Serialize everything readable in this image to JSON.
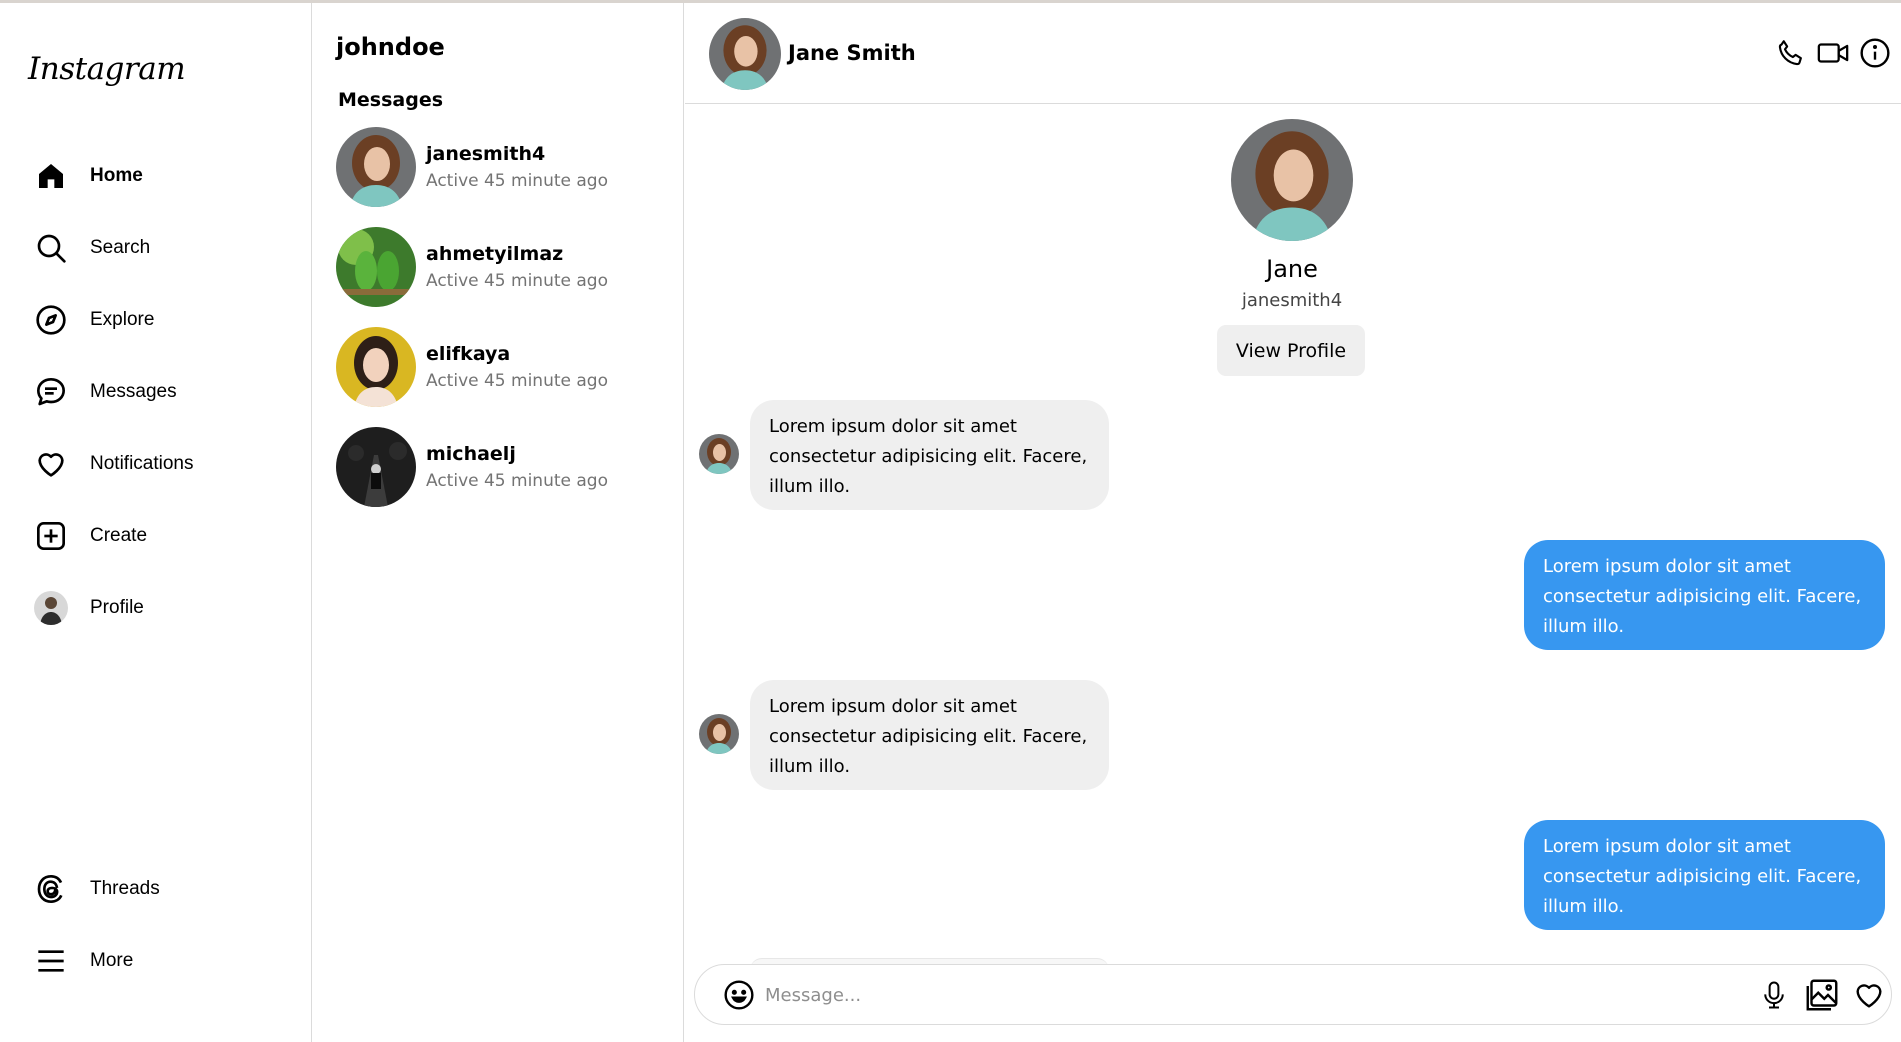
{
  "app": {
    "logo_text": "Instagram"
  },
  "nav": {
    "items": [
      {
        "id": "home",
        "label": "Home",
        "icon": "home-icon"
      },
      {
        "id": "search",
        "label": "Search",
        "icon": "search-icon"
      },
      {
        "id": "explore",
        "label": "Explore",
        "icon": "compass-icon"
      },
      {
        "id": "messages",
        "label": "Messages",
        "icon": "chat-bubble-icon"
      },
      {
        "id": "notifications",
        "label": "Notifications",
        "icon": "heart-icon"
      },
      {
        "id": "create",
        "label": "Create",
        "icon": "plus-square-icon"
      },
      {
        "id": "profile",
        "label": "Profile",
        "icon": "avatar"
      }
    ],
    "bottom": [
      {
        "id": "threads",
        "label": "Threads",
        "icon": "threads-icon"
      },
      {
        "id": "more",
        "label": "More",
        "icon": "menu-icon"
      }
    ]
  },
  "conversations": {
    "username": "johndoe",
    "heading": "Messages",
    "items": [
      {
        "name": "janesmith4",
        "status": "Active 45 minute ago"
      },
      {
        "name": "ahmetyilmaz",
        "status": "Active 45 minute ago"
      },
      {
        "name": "elifkaya",
        "status": "Active 45 minute ago"
      },
      {
        "name": "michaelj",
        "status": "Active 45 minute ago"
      }
    ]
  },
  "chat": {
    "header_name": "Jane Smith",
    "header_icons": [
      "phone-icon",
      "video-icon",
      "info-icon"
    ],
    "profile": {
      "name": "Jane",
      "handle": "janesmith4",
      "button": "View Profile"
    },
    "messages": [
      {
        "direction": "in",
        "text": "Lorem ipsum dolor sit amet consectetur adipisicing elit. Facere, illum illo."
      },
      {
        "direction": "out",
        "text": "Lorem ipsum dolor sit amet consectetur adipisicing elit. Facere, illum illo."
      },
      {
        "direction": "in",
        "text": "Lorem ipsum dolor sit amet consectetur adipisicing elit. Facere, illum illo."
      },
      {
        "direction": "out",
        "text": "Lorem ipsum dolor sit amet consectetur adipisicing elit. Facere, illum illo."
      }
    ],
    "composer": {
      "placeholder": "Message...",
      "value": "",
      "icons": [
        "emoji-icon",
        "microphone-icon",
        "image-icon",
        "heart-icon"
      ]
    }
  },
  "colors": {
    "outgoing_bubble": "#3797f0",
    "incoming_bubble": "#efefef",
    "border": "#dbdbdb",
    "muted_text": "#737373"
  }
}
